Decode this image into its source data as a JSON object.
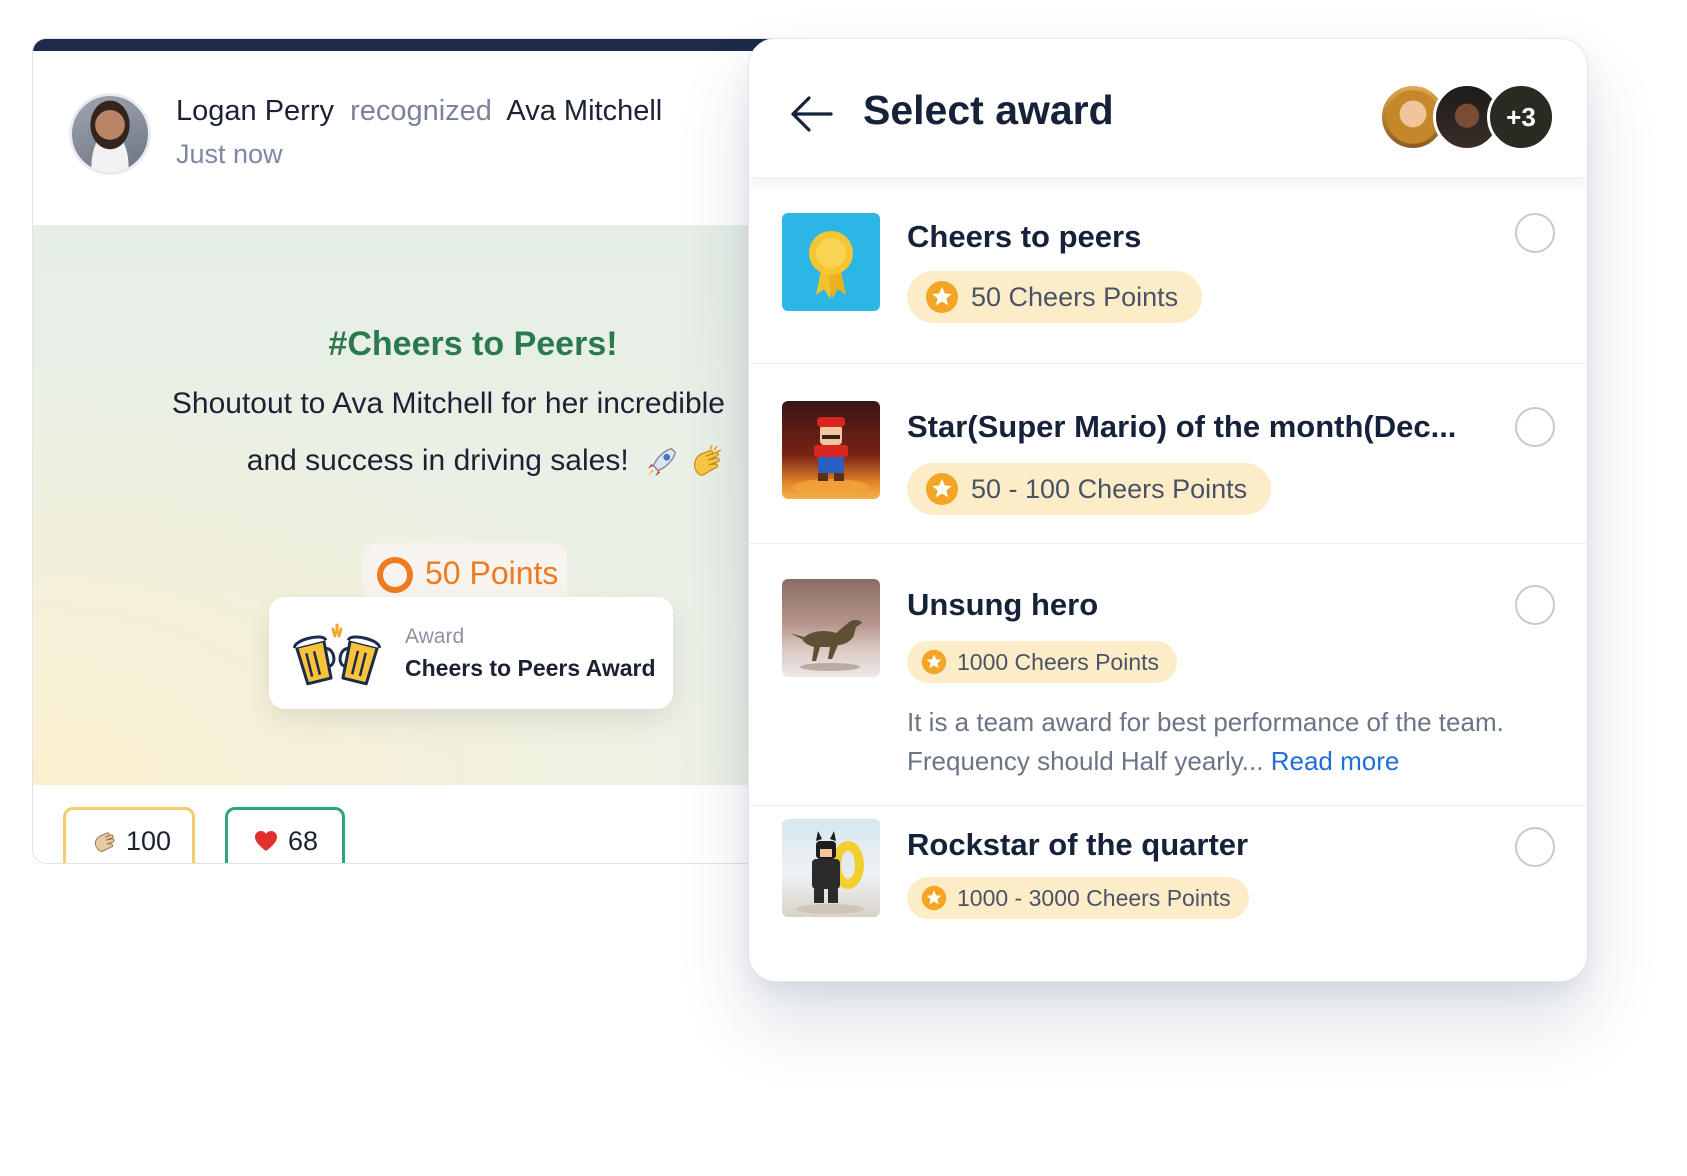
{
  "post": {
    "author": "Logan Perry",
    "verb": "recognized",
    "recipient": "Ava Mitchell",
    "time": "Just now",
    "hashtag": "#Cheers to Peers!",
    "message_line1": "Shoutout to Ava Mitchell for her incredible",
    "message_line2": "and success in driving sales!",
    "points": "50 Points",
    "award_caption": "Award",
    "award_name": "Cheers to Peers Award",
    "reactions": {
      "clap_count": "100",
      "heart_count": "68"
    }
  },
  "panel": {
    "title": "Select award",
    "more_avatars": "+3",
    "awards": [
      {
        "title": "Cheers to peers",
        "points": "50 Cheers Points",
        "image": "ribbon-medal"
      },
      {
        "title": "Star(Super Mario) of the month(Dec...",
        "points": "50 - 100 Cheers Points",
        "image": "mario-figure"
      },
      {
        "title": "Unsung hero",
        "points": "1000 Cheers Points",
        "description": "It is a team award for best performance of the team. Frequency should Half yearly...",
        "read_more": "Read more",
        "image": "dinosaur-figure"
      },
      {
        "title": "Rockstar of the quarter",
        "points": "1000 - 3000 Cheers Points",
        "image": "batman-figure"
      }
    ]
  },
  "colors": {
    "accent_green": "#2b7a4f",
    "points_orange": "#f07b1f",
    "link_blue": "#1f6fd8",
    "pill_bg": "#fdecc8"
  }
}
